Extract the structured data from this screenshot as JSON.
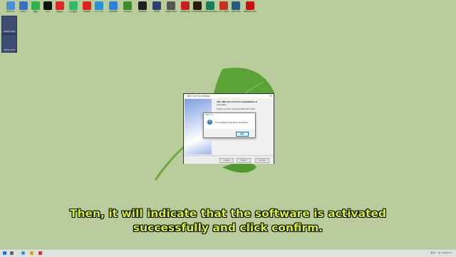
{
  "desktop": {
    "top_icons": [
      {
        "label": "BROVO",
        "color": "#4a8fd8"
      },
      {
        "label": "GBEO",
        "color": "#3a6fc8"
      },
      {
        "label": "微信",
        "color": "#2bb24c"
      },
      {
        "label": "QQ",
        "color": "#111111"
      },
      {
        "label": "网易云",
        "color": "#e02828"
      },
      {
        "label": "QQ音乐",
        "color": "#33b86b"
      },
      {
        "label": "Adobe",
        "color": "#dd2020"
      },
      {
        "label": "Λ 2.3.9",
        "color": "#2a8fd8"
      },
      {
        "label": "Softwell",
        "color": "#2a7fd8"
      },
      {
        "label": "NVIDIA",
        "color": "#3c8c2c"
      },
      {
        "label": "Nvideo",
        "color": "#1f1f1f"
      },
      {
        "label": "Shab",
        "color": "#2a4070"
      },
      {
        "label": "GigaHertz",
        "color": "#555555"
      },
      {
        "label": "AutoCAD",
        "color": "#c82020"
      },
      {
        "label": "Illustrator",
        "color": "#2b1a0c"
      },
      {
        "label": "Gaia3DSMAX",
        "color": "#148060"
      },
      {
        "label": "GTF Tools",
        "color": "#c83020"
      },
      {
        "label": "3ds Max",
        "color": "#2a5a80"
      },
      {
        "label": "RoboDriver",
        "color": "#cc1010"
      }
    ],
    "side_icons": [
      {
        "label": "AUTO CAD"
      },
      {
        "label": "AUTO CAD"
      }
    ]
  },
  "installer": {
    "title": "3DS Cut 3.0.6 Setup",
    "line1": "The 3DS Cut 3.0.6 Pro installation is",
    "line2": "complete.",
    "line3": "Thank you for choosing 3DS Cut 3.0.6!",
    "back_label": "< Back",
    "finish_label": "Finish",
    "cancel_label": "Cancel"
  },
  "alert": {
    "title": "3DS Cut",
    "message": "The software has been activated",
    "ok_label": "确定"
  },
  "subtitle": {
    "line1": "Then, it will indicate that the software is activated",
    "line2": "successfully and click confirm."
  },
  "taskbar": {
    "tray_text": "英 中 ⌃ 🔊 2023/1/1"
  }
}
